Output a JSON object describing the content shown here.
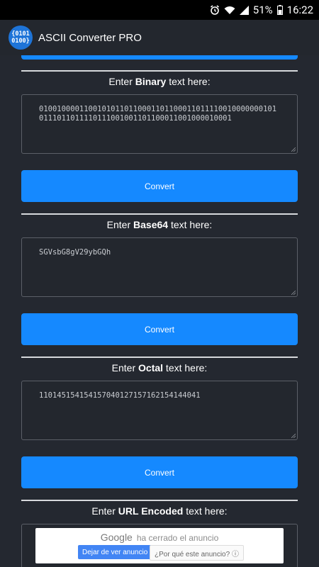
{
  "status_bar": {
    "battery_percent": "51%",
    "time": "16:22"
  },
  "app": {
    "title": "ASCII Converter PRO",
    "logo_line1": "{0101",
    "logo_line2": "0100}"
  },
  "sections": [
    {
      "label_prefix": "Enter ",
      "label_bold": "Binary",
      "label_suffix": " text here:",
      "value": "010010000110010101101100011011000110111100100000001010111011011110111001001101100011001000010001"
    },
    {
      "label_prefix": "Enter ",
      "label_bold": "Base64",
      "label_suffix": " text here:",
      "value": "SGVsbG8gV29ybGQh"
    },
    {
      "label_prefix": "Enter ",
      "label_bold": "Octal",
      "label_suffix": " text here:",
      "value": "110145154154157040127157162154144041"
    },
    {
      "label_prefix": "Enter ",
      "label_bold": "URL Encoded",
      "label_suffix": " text here:",
      "value": ""
    }
  ],
  "convert_label": "Convert",
  "ad": {
    "google": "Google",
    "closed_text": "ha cerrado el anuncio",
    "stop_button": "Dejar de ver anuncio",
    "why_button": "¿Por qué este anuncio? ⓘ"
  },
  "colors": {
    "accent": "#1589ff",
    "background": "#242830",
    "field_border": "#5c6068"
  }
}
